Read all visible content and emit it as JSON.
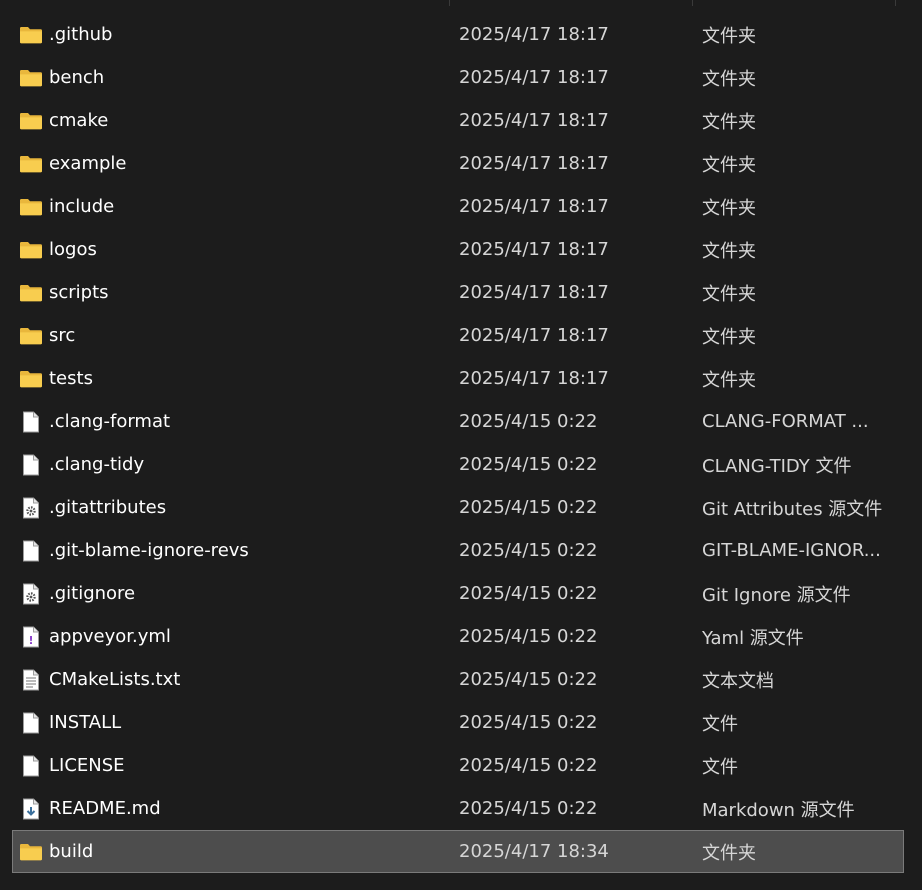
{
  "files": [
    {
      "name": ".github",
      "date": "2025/4/17 18:17",
      "type": "文件夹",
      "icon": "folder-icon"
    },
    {
      "name": "bench",
      "date": "2025/4/17 18:17",
      "type": "文件夹",
      "icon": "folder-icon"
    },
    {
      "name": "cmake",
      "date": "2025/4/17 18:17",
      "type": "文件夹",
      "icon": "folder-icon"
    },
    {
      "name": "example",
      "date": "2025/4/17 18:17",
      "type": "文件夹",
      "icon": "folder-icon"
    },
    {
      "name": "include",
      "date": "2025/4/17 18:17",
      "type": "文件夹",
      "icon": "folder-icon"
    },
    {
      "name": "logos",
      "date": "2025/4/17 18:17",
      "type": "文件夹",
      "icon": "folder-icon"
    },
    {
      "name": "scripts",
      "date": "2025/4/17 18:17",
      "type": "文件夹",
      "icon": "folder-icon"
    },
    {
      "name": "src",
      "date": "2025/4/17 18:17",
      "type": "文件夹",
      "icon": "folder-icon"
    },
    {
      "name": "tests",
      "date": "2025/4/17 18:17",
      "type": "文件夹",
      "icon": "folder-icon"
    },
    {
      "name": ".clang-format",
      "date": "2025/4/15 0:22",
      "type": "CLANG-FORMAT ...",
      "icon": "file-icon"
    },
    {
      "name": ".clang-tidy",
      "date": "2025/4/15 0:22",
      "type": "CLANG-TIDY 文件",
      "icon": "file-icon"
    },
    {
      "name": ".gitattributes",
      "date": "2025/4/15 0:22",
      "type": "Git Attributes 源文件",
      "icon": "gear-file-icon"
    },
    {
      "name": ".git-blame-ignore-revs",
      "date": "2025/4/15 0:22",
      "type": "GIT-BLAME-IGNOR...",
      "icon": "file-icon"
    },
    {
      "name": ".gitignore",
      "date": "2025/4/15 0:22",
      "type": "Git Ignore 源文件",
      "icon": "gear-file-icon"
    },
    {
      "name": "appveyor.yml",
      "date": "2025/4/15 0:22",
      "type": "Yaml 源文件",
      "icon": "yaml-file-icon"
    },
    {
      "name": "CMakeLists.txt",
      "date": "2025/4/15 0:22",
      "type": "文本文档",
      "icon": "text-file-icon"
    },
    {
      "name": "INSTALL",
      "date": "2025/4/15 0:22",
      "type": "文件",
      "icon": "file-icon"
    },
    {
      "name": "LICENSE",
      "date": "2025/4/15 0:22",
      "type": "文件",
      "icon": "file-icon"
    },
    {
      "name": "README.md",
      "date": "2025/4/15 0:22",
      "type": "Markdown 源文件",
      "icon": "markdown-file-icon"
    },
    {
      "name": "build",
      "date": "2025/4/17 18:34",
      "type": "文件夹",
      "icon": "folder-icon",
      "selected": true
    }
  ],
  "colors": {
    "background": "#1c1c1c",
    "selected_row": "#4d4d4d",
    "folder": "#f7c948",
    "text": "#ffffff",
    "secondary_text": "#d6d6d6"
  }
}
